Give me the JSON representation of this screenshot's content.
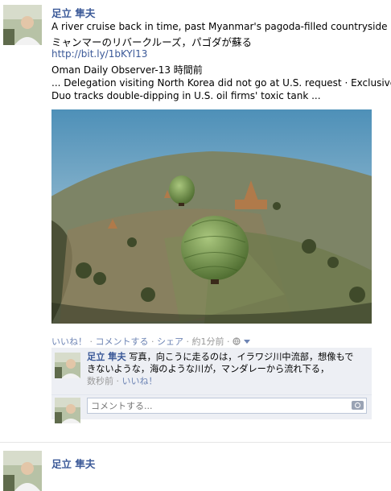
{
  "post": {
    "author": "足立 隼夫",
    "headline_en": "A river cruise back in time, past Myanmar's pagoda-filled countryside",
    "headline_ja": "ミャンマーのリバークルーズ，パゴダが蘇る",
    "link": "http://bit.ly/1bKYl13",
    "source": "Oman Daily Observer-13 時間前",
    "snippet": "... Delegation visiting North Korea did not go at U.S. request · Exclusive:",
    "snippet2": "Duo tracks double-dipping in U.S. oil firms' toxic tank ...",
    "actions": {
      "like": "いいね！",
      "comment": "コメントする",
      "share": "シェア",
      "time": "約1分前",
      "sep": "·"
    }
  },
  "comment": {
    "author": "足立 隼夫",
    "line1": " 写真，向こうに走るのは，イラワジ川中流部，想像もで",
    "line2": "きないような，海のような川が，マンダレーから流れ下る，",
    "time": "数秒前",
    "like": "いいね！"
  },
  "compose": {
    "placeholder": "コメントする..."
  },
  "next_post": {
    "author": "足立 隼夫"
  },
  "colors": {
    "link_blue": "#3b5998",
    "action_blue": "#6d84b4",
    "comment_bg": "#edeff4"
  }
}
